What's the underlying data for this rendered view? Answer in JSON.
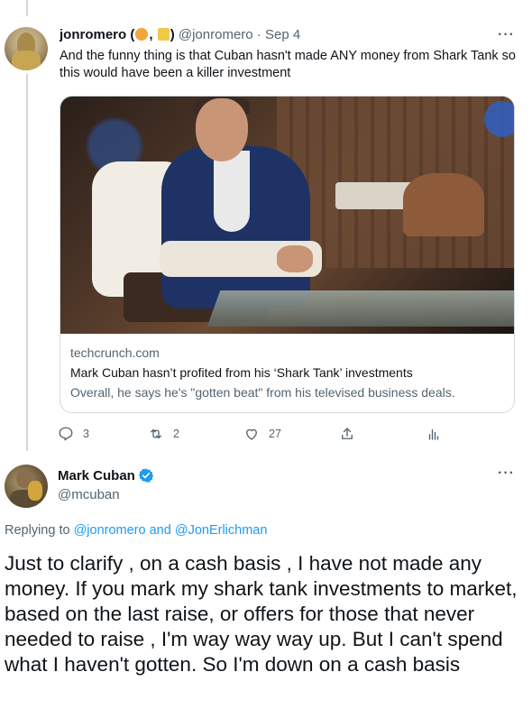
{
  "tweet1": {
    "author_name": "jonromero",
    "name_open_paren": "(",
    "name_comma": ",",
    "name_close_paren": ")",
    "emoji_1_icon": "lollipop-icon",
    "emoji_2_icon": "scroll-icon",
    "handle": "@jonromero",
    "separator": "·",
    "date": "Sep 4",
    "more_label": "···",
    "text": "And the funny thing is that Cuban hasn't made ANY money from Shark Tank so this would have been a killer investment",
    "card": {
      "domain": "techcrunch.com",
      "title": "Mark Cuban hasn’t profited from his ‘Shark Tank’ investments",
      "description": "Overall, he says he's \"gotten beat\" from his televised business deals."
    },
    "actions": {
      "replies": "3",
      "retweets": "2",
      "likes": "27"
    }
  },
  "tweet2": {
    "author_name": "Mark Cuban",
    "handle": "@mcuban",
    "more_label": "···",
    "replying_prefix": "Replying to",
    "replying_user1": "@jonromero",
    "replying_and": "and",
    "replying_user2": "@JonErlichman",
    "text": "Just to clarify , on a cash basis , I have not made any money. If you mark my shark tank investments to market, based on the last raise, or offers for those that never needed to raise ,  I'm way way way up.  But I can't spend what I haven't gotten. So I'm down on a cash basis"
  },
  "colors": {
    "text": "#0f1419",
    "secondary": "#536471",
    "accent": "#1d9bf0",
    "border": "#cfd9de"
  }
}
